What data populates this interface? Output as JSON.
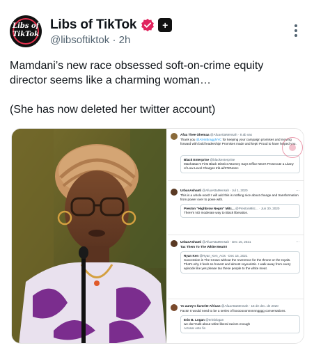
{
  "author": {
    "display_name": "Libs of TikTok",
    "handle": "@libsoftiktok",
    "time": "2h",
    "avatar_logo_line1": "Libs of",
    "avatar_logo_line2": "TikTok"
  },
  "tweet": {
    "line1": "Mamdani’s new race obsessed soft-on-crime equity director seems like a charming woman…",
    "line2": "(She has now deleted her twitter account)"
  },
  "screenshots": [
    {
      "name": "Afua Thee Ohemaa",
      "handle": "@AfuaAttaMensah · 8 ab vas",
      "body_pre": "Thank you ",
      "body_link": "@AlvinBraggNYC",
      "body_post": " for keeping your campaign promises and moving forward with bold leadership! Promises made and kept! Proud to have helped you.",
      "quote_name": "Black Enterprise",
      "quote_handle": "@blackenterprise",
      "quote_text": "Manhattan's First Black District Attorney Says Office Won't Prosecute a Litany of Low-Level Charges trib.al/37KNomc"
    },
    {
      "name": "UrbanAshanti",
      "handle": "@AfuaAttaMensah · Jul 1, 2020",
      "body": "This is a whole word! I will add this is nothing nice about change and transformation from power over to powe with.",
      "quote_name": "Preston \"Highbrow Negro\" Mitc...",
      "quote_handle": "@PrestonMitc... · Jun 30, 2020",
      "quote_text": "There's NO moderate way to Black liberation."
    },
    {
      "name": "UrbanAshanti",
      "handle": "@AfuaAttaMensah · Dec 15, 2021",
      "body": "Tax Them To The White Meat!!!",
      "quote_name": "Ryan Ken",
      "quote_handle": "@Ryan_Ken_Acts · Dec 15, 2021",
      "quote_text": "Succession is The Crown without the reverence for the throne or the royals. That's why it feels so honest and almost voyeuristic. I walk away from every episode like yes please tax these people to the white meat."
    },
    {
      "name": "Yo aunty's favorite African",
      "handle": "@AfuaAttaMensah · 15 de dec. de 2020",
      "body": "Facts! It would need to be a series of looooooonnnnnngggg conversations.",
      "quote_name": "Erin B. Logan",
      "quote_handle": "@erinblogan",
      "quote_text": "we don't talk about white liberal racism enough",
      "quote_extra": "Arrosar este fio"
    }
  ],
  "colors": {
    "verified_badge": "#e0245e",
    "handle_gray": "#536471",
    "link_blue": "#1d9bf0"
  },
  "icons": [
    "verified-badge-icon",
    "affiliate-plus-icon",
    "more-options-icon"
  ]
}
